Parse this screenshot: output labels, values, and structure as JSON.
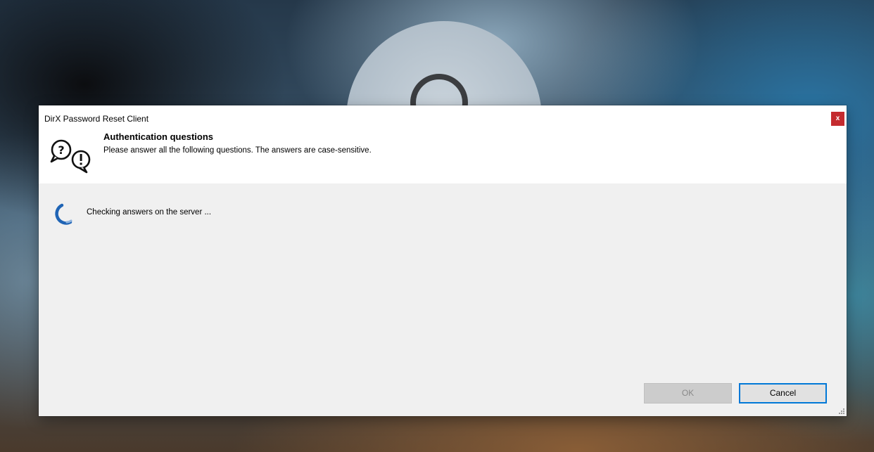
{
  "window": {
    "title": "DirX Password Reset Client",
    "close_label": "x"
  },
  "header": {
    "heading": "Authentication questions",
    "subheading": "Please answer all the following questions. The answers are case-sensitive.",
    "icon": "question-answer-bubbles-icon"
  },
  "status": {
    "message": "Checking answers on the server ...",
    "icon": "loading-spinner-icon"
  },
  "buttons": {
    "ok_label": "OK",
    "cancel_label": "Cancel"
  },
  "colors": {
    "close_button": "#c42b2f",
    "accent": "#0078d7",
    "dialog_body": "#f0f0f0",
    "header": "#ffffff"
  }
}
